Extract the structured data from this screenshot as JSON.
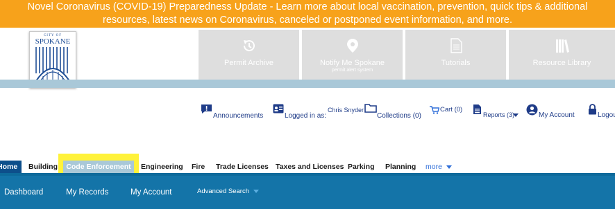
{
  "alert": {
    "line1": "Novel Coronavirus (COVID-19) Preparedness Update - Learn more about local vaccination, prevention, quick tips & additional",
    "line2": "resources, latest news on Coronavirus, canceled or postponed event information, and more."
  },
  "logo": {
    "city_text": "CITY OF",
    "name_text": "SPOKANE"
  },
  "tiles": [
    {
      "label": "Permit Archive",
      "icon": "history-icon"
    },
    {
      "label": "Notify Me Spokane",
      "sub": "permit alert system",
      "icon": "location-pin-icon"
    },
    {
      "label": "Tutorials",
      "icon": "document-icon"
    },
    {
      "label": "Resource Library",
      "icon": "books-icon"
    }
  ],
  "utility": {
    "announcements": "Announcements",
    "logged_in_as": "Logged in as:",
    "user_name": "Chris Snyder",
    "collections": "Collections (0)",
    "cart": "Cart (0)",
    "reports": "Reports (3)",
    "my_account": "My Account",
    "logout": "Logou"
  },
  "nav": {
    "home": "Home",
    "items": [
      "Building",
      "Code Enforcement",
      "Engineering",
      "Fire",
      "Trade Licenses",
      "Taxes and Licenses",
      "Parking",
      "Planning"
    ],
    "more": "more"
  },
  "subnav": {
    "dashboard": "Dashboard",
    "my_records": "My Records",
    "my_account": "My Account",
    "advanced_search": "Advanced Search"
  },
  "colors": {
    "banner": "#f7a21b",
    "tile": "#dedede",
    "nav_blue": "#1474a8",
    "highlight": "#fff23a",
    "active_tab": "#a9c8d8",
    "link": "#1f3c88"
  }
}
